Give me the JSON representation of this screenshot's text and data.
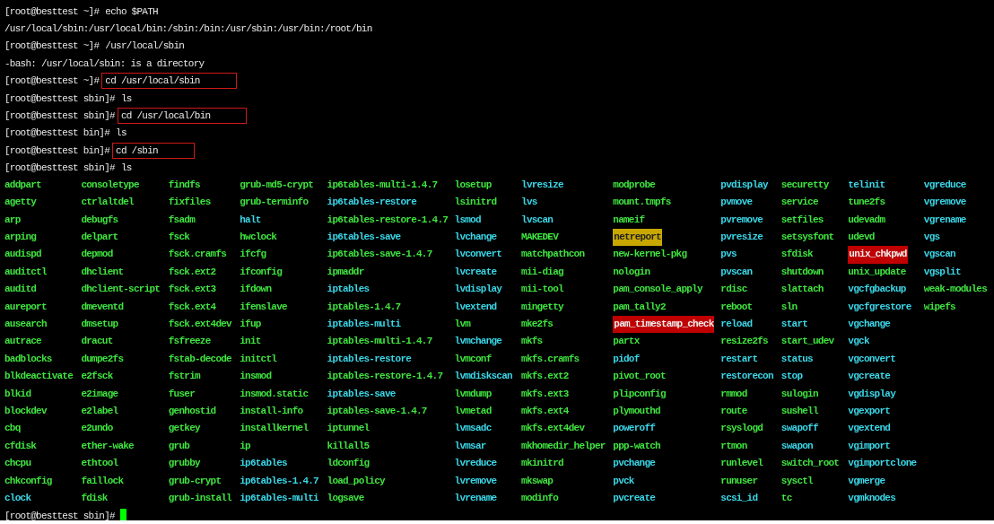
{
  "lines": [
    {
      "kind": "prompt",
      "prompt": "[root@besttest ~]#",
      "command": "echo $PATH",
      "boxed": false
    },
    {
      "kind": "output",
      "text": "/usr/local/sbin:/usr/local/bin:/sbin:/bin:/usr/sbin:/usr/bin:/root/bin"
    },
    {
      "kind": "prompt",
      "prompt": "[root@besttest ~]#",
      "command": "/usr/local/sbin",
      "boxed": false
    },
    {
      "kind": "output",
      "text": "-bash: /usr/local/sbin: is a directory"
    },
    {
      "kind": "prompt",
      "prompt": "[root@besttest ~]#",
      "command": "cd /usr/local/sbin",
      "boxed": true
    },
    {
      "kind": "prompt",
      "prompt": "[root@besttest sbin]#",
      "command": "ls",
      "boxed": false
    },
    {
      "kind": "prompt",
      "prompt": "[root@besttest sbin]#",
      "command": "cd /usr/local/bin",
      "boxed": true
    },
    {
      "kind": "prompt",
      "prompt": "[root@besttest bin]#",
      "command": "ls",
      "boxed": false
    },
    {
      "kind": "prompt",
      "prompt": "[root@besttest bin]#",
      "command": "cd /sbin",
      "boxed": true
    },
    {
      "kind": "prompt",
      "prompt": "[root@besttest sbin]#",
      "command": "ls",
      "boxed": false
    }
  ],
  "listing": [
    [
      {
        "name": "addpart",
        "kind": "exec"
      },
      {
        "name": "agetty",
        "kind": "exec"
      },
      {
        "name": "arp",
        "kind": "exec"
      },
      {
        "name": "arping",
        "kind": "exec"
      },
      {
        "name": "audispd",
        "kind": "exec"
      },
      {
        "name": "auditctl",
        "kind": "exec"
      },
      {
        "name": "auditd",
        "kind": "exec"
      },
      {
        "name": "aureport",
        "kind": "exec"
      },
      {
        "name": "ausearch",
        "kind": "exec"
      },
      {
        "name": "autrace",
        "kind": "exec"
      },
      {
        "name": "badblocks",
        "kind": "exec"
      },
      {
        "name": "blkdeactivate",
        "kind": "exec"
      },
      {
        "name": "blkid",
        "kind": "exec"
      },
      {
        "name": "blockdev",
        "kind": "exec"
      },
      {
        "name": "cbq",
        "kind": "exec"
      },
      {
        "name": "cfdisk",
        "kind": "exec"
      },
      {
        "name": "chcpu",
        "kind": "exec"
      },
      {
        "name": "chkconfig",
        "kind": "exec"
      },
      {
        "name": "clock",
        "kind": "link"
      }
    ],
    [
      {
        "name": "consoletype",
        "kind": "exec"
      },
      {
        "name": "ctrlaltdel",
        "kind": "exec"
      },
      {
        "name": "debugfs",
        "kind": "exec"
      },
      {
        "name": "delpart",
        "kind": "exec"
      },
      {
        "name": "depmod",
        "kind": "exec"
      },
      {
        "name": "dhclient",
        "kind": "exec"
      },
      {
        "name": "dhclient-script",
        "kind": "exec"
      },
      {
        "name": "dmeventd",
        "kind": "exec"
      },
      {
        "name": "dmsetup",
        "kind": "exec"
      },
      {
        "name": "dracut",
        "kind": "exec"
      },
      {
        "name": "dumpe2fs",
        "kind": "exec"
      },
      {
        "name": "e2fsck",
        "kind": "exec"
      },
      {
        "name": "e2image",
        "kind": "exec"
      },
      {
        "name": "e2label",
        "kind": "exec"
      },
      {
        "name": "e2undo",
        "kind": "exec"
      },
      {
        "name": "ether-wake",
        "kind": "exec"
      },
      {
        "name": "ethtool",
        "kind": "exec"
      },
      {
        "name": "faillock",
        "kind": "exec"
      },
      {
        "name": "fdisk",
        "kind": "exec"
      }
    ],
    [
      {
        "name": "findfs",
        "kind": "exec"
      },
      {
        "name": "fixfiles",
        "kind": "exec"
      },
      {
        "name": "fsadm",
        "kind": "exec"
      },
      {
        "name": "fsck",
        "kind": "exec"
      },
      {
        "name": "fsck.cramfs",
        "kind": "exec"
      },
      {
        "name": "fsck.ext2",
        "kind": "exec"
      },
      {
        "name": "fsck.ext3",
        "kind": "exec"
      },
      {
        "name": "fsck.ext4",
        "kind": "exec"
      },
      {
        "name": "fsck.ext4dev",
        "kind": "exec"
      },
      {
        "name": "fsfreeze",
        "kind": "exec"
      },
      {
        "name": "fstab-decode",
        "kind": "exec"
      },
      {
        "name": "fstrim",
        "kind": "exec"
      },
      {
        "name": "fuser",
        "kind": "exec"
      },
      {
        "name": "genhostid",
        "kind": "exec"
      },
      {
        "name": "getkey",
        "kind": "exec"
      },
      {
        "name": "grub",
        "kind": "exec"
      },
      {
        "name": "grubby",
        "kind": "exec"
      },
      {
        "name": "grub-crypt",
        "kind": "exec"
      },
      {
        "name": "grub-install",
        "kind": "exec"
      }
    ],
    [
      {
        "name": "grub-md5-crypt",
        "kind": "exec"
      },
      {
        "name": "grub-terminfo",
        "kind": "exec"
      },
      {
        "name": "halt",
        "kind": "link"
      },
      {
        "name": "hwclock",
        "kind": "exec"
      },
      {
        "name": "ifcfg",
        "kind": "exec"
      },
      {
        "name": "ifconfig",
        "kind": "exec"
      },
      {
        "name": "ifdown",
        "kind": "exec"
      },
      {
        "name": "ifenslave",
        "kind": "exec"
      },
      {
        "name": "ifup",
        "kind": "exec"
      },
      {
        "name": "init",
        "kind": "exec"
      },
      {
        "name": "initctl",
        "kind": "exec"
      },
      {
        "name": "insmod",
        "kind": "exec"
      },
      {
        "name": "insmod.static",
        "kind": "exec"
      },
      {
        "name": "install-info",
        "kind": "exec"
      },
      {
        "name": "installkernel",
        "kind": "exec"
      },
      {
        "name": "ip",
        "kind": "exec"
      },
      {
        "name": "ip6tables",
        "kind": "link"
      },
      {
        "name": "ip6tables-1.4.7",
        "kind": "link"
      },
      {
        "name": "ip6tables-multi",
        "kind": "link"
      }
    ],
    [
      {
        "name": "ip6tables-multi-1.4.7",
        "kind": "exec"
      },
      {
        "name": "ip6tables-restore",
        "kind": "link"
      },
      {
        "name": "ip6tables-restore-1.4.7",
        "kind": "exec"
      },
      {
        "name": "ip6tables-save",
        "kind": "link"
      },
      {
        "name": "ip6tables-save-1.4.7",
        "kind": "exec"
      },
      {
        "name": "ipmaddr",
        "kind": "exec"
      },
      {
        "name": "iptables",
        "kind": "link"
      },
      {
        "name": "iptables-1.4.7",
        "kind": "exec"
      },
      {
        "name": "iptables-multi",
        "kind": "link"
      },
      {
        "name": "iptables-multi-1.4.7",
        "kind": "exec"
      },
      {
        "name": "iptables-restore",
        "kind": "link"
      },
      {
        "name": "iptables-restore-1.4.7",
        "kind": "exec"
      },
      {
        "name": "iptables-save",
        "kind": "link"
      },
      {
        "name": "iptables-save-1.4.7",
        "kind": "exec"
      },
      {
        "name": "iptunnel",
        "kind": "exec"
      },
      {
        "name": "killall5",
        "kind": "exec"
      },
      {
        "name": "ldconfig",
        "kind": "exec"
      },
      {
        "name": "load_policy",
        "kind": "exec"
      },
      {
        "name": "logsave",
        "kind": "exec"
      }
    ],
    [
      {
        "name": "losetup",
        "kind": "exec"
      },
      {
        "name": "lsinitrd",
        "kind": "exec"
      },
      {
        "name": "lsmod",
        "kind": "link"
      },
      {
        "name": "lvchange",
        "kind": "link"
      },
      {
        "name": "lvconvert",
        "kind": "link"
      },
      {
        "name": "lvcreate",
        "kind": "link"
      },
      {
        "name": "lvdisplay",
        "kind": "link"
      },
      {
        "name": "lvextend",
        "kind": "link"
      },
      {
        "name": "lvm",
        "kind": "exec"
      },
      {
        "name": "lvmchange",
        "kind": "link"
      },
      {
        "name": "lvmconf",
        "kind": "exec"
      },
      {
        "name": "lvmdiskscan",
        "kind": "link"
      },
      {
        "name": "lvmdump",
        "kind": "exec"
      },
      {
        "name": "lvmetad",
        "kind": "exec"
      },
      {
        "name": "lvmsadc",
        "kind": "link"
      },
      {
        "name": "lvmsar",
        "kind": "link"
      },
      {
        "name": "lvreduce",
        "kind": "link"
      },
      {
        "name": "lvremove",
        "kind": "link"
      },
      {
        "name": "lvrename",
        "kind": "link"
      }
    ],
    [
      {
        "name": "lvresize",
        "kind": "link"
      },
      {
        "name": "lvs",
        "kind": "link"
      },
      {
        "name": "lvscan",
        "kind": "link"
      },
      {
        "name": "MAKEDEV",
        "kind": "exec"
      },
      {
        "name": "matchpathcon",
        "kind": "exec"
      },
      {
        "name": "mii-diag",
        "kind": "exec"
      },
      {
        "name": "mii-tool",
        "kind": "exec"
      },
      {
        "name": "mingetty",
        "kind": "exec"
      },
      {
        "name": "mke2fs",
        "kind": "exec"
      },
      {
        "name": "mkfs",
        "kind": "exec"
      },
      {
        "name": "mkfs.cramfs",
        "kind": "exec"
      },
      {
        "name": "mkfs.ext2",
        "kind": "exec"
      },
      {
        "name": "mkfs.ext3",
        "kind": "exec"
      },
      {
        "name": "mkfs.ext4",
        "kind": "exec"
      },
      {
        "name": "mkfs.ext4dev",
        "kind": "exec"
      },
      {
        "name": "mkhomedir_helper",
        "kind": "exec"
      },
      {
        "name": "mkinitrd",
        "kind": "exec"
      },
      {
        "name": "mkswap",
        "kind": "exec"
      },
      {
        "name": "modinfo",
        "kind": "exec"
      }
    ],
    [
      {
        "name": "modprobe",
        "kind": "exec"
      },
      {
        "name": "mount.tmpfs",
        "kind": "exec"
      },
      {
        "name": "nameif",
        "kind": "exec"
      },
      {
        "name": "netreport",
        "kind": "setgid"
      },
      {
        "name": "new-kernel-pkg",
        "kind": "exec"
      },
      {
        "name": "nologin",
        "kind": "exec"
      },
      {
        "name": "pam_console_apply",
        "kind": "exec"
      },
      {
        "name": "pam_tally2",
        "kind": "exec"
      },
      {
        "name": "pam_timestamp_check",
        "kind": "setuid"
      },
      {
        "name": "partx",
        "kind": "exec"
      },
      {
        "name": "pidof",
        "kind": "link"
      },
      {
        "name": "pivot_root",
        "kind": "exec"
      },
      {
        "name": "plipconfig",
        "kind": "exec"
      },
      {
        "name": "plymouthd",
        "kind": "exec"
      },
      {
        "name": "poweroff",
        "kind": "link"
      },
      {
        "name": "ppp-watch",
        "kind": "exec"
      },
      {
        "name": "pvchange",
        "kind": "link"
      },
      {
        "name": "pvck",
        "kind": "link"
      },
      {
        "name": "pvcreate",
        "kind": "link"
      }
    ],
    [
      {
        "name": "pvdisplay",
        "kind": "link"
      },
      {
        "name": "pvmove",
        "kind": "link"
      },
      {
        "name": "pvremove",
        "kind": "link"
      },
      {
        "name": "pvresize",
        "kind": "link"
      },
      {
        "name": "pvs",
        "kind": "link"
      },
      {
        "name": "pvscan",
        "kind": "link"
      },
      {
        "name": "rdisc",
        "kind": "exec"
      },
      {
        "name": "reboot",
        "kind": "exec"
      },
      {
        "name": "reload",
        "kind": "link"
      },
      {
        "name": "resize2fs",
        "kind": "exec"
      },
      {
        "name": "restart",
        "kind": "link"
      },
      {
        "name": "restorecon",
        "kind": "link"
      },
      {
        "name": "rmmod",
        "kind": "exec"
      },
      {
        "name": "route",
        "kind": "exec"
      },
      {
        "name": "rsyslogd",
        "kind": "exec"
      },
      {
        "name": "rtmon",
        "kind": "exec"
      },
      {
        "name": "runlevel",
        "kind": "exec"
      },
      {
        "name": "runuser",
        "kind": "exec"
      },
      {
        "name": "scsi_id",
        "kind": "link"
      }
    ],
    [
      {
        "name": "securetty",
        "kind": "exec"
      },
      {
        "name": "service",
        "kind": "exec"
      },
      {
        "name": "setfiles",
        "kind": "exec"
      },
      {
        "name": "setsysfont",
        "kind": "exec"
      },
      {
        "name": "sfdisk",
        "kind": "exec"
      },
      {
        "name": "shutdown",
        "kind": "exec"
      },
      {
        "name": "slattach",
        "kind": "exec"
      },
      {
        "name": "sln",
        "kind": "exec"
      },
      {
        "name": "start",
        "kind": "link"
      },
      {
        "name": "start_udev",
        "kind": "exec"
      },
      {
        "name": "status",
        "kind": "link"
      },
      {
        "name": "stop",
        "kind": "link"
      },
      {
        "name": "sulogin",
        "kind": "exec"
      },
      {
        "name": "sushell",
        "kind": "exec"
      },
      {
        "name": "swapoff",
        "kind": "link"
      },
      {
        "name": "swapon",
        "kind": "link"
      },
      {
        "name": "switch_root",
        "kind": "exec"
      },
      {
        "name": "sysctl",
        "kind": "exec"
      },
      {
        "name": "tc",
        "kind": "exec"
      }
    ],
    [
      {
        "name": "telinit",
        "kind": "link"
      },
      {
        "name": "tune2fs",
        "kind": "exec"
      },
      {
        "name": "udevadm",
        "kind": "exec"
      },
      {
        "name": "udevd",
        "kind": "exec"
      },
      {
        "name": "unix_chkpwd",
        "kind": "setuid"
      },
      {
        "name": "unix_update",
        "kind": "exec"
      },
      {
        "name": "vgcfgbackup",
        "kind": "link"
      },
      {
        "name": "vgcfgrestore",
        "kind": "link"
      },
      {
        "name": "vgchange",
        "kind": "link"
      },
      {
        "name": "vgck",
        "kind": "link"
      },
      {
        "name": "vgconvert",
        "kind": "link"
      },
      {
        "name": "vgcreate",
        "kind": "link"
      },
      {
        "name": "vgdisplay",
        "kind": "link"
      },
      {
        "name": "vgexport",
        "kind": "link"
      },
      {
        "name": "vgextend",
        "kind": "link"
      },
      {
        "name": "vgimport",
        "kind": "link"
      },
      {
        "name": "vgimportclone",
        "kind": "link"
      },
      {
        "name": "vgmerge",
        "kind": "link"
      },
      {
        "name": "vgmknodes",
        "kind": "link"
      }
    ],
    [
      {
        "name": "vgreduce",
        "kind": "link"
      },
      {
        "name": "vgremove",
        "kind": "link"
      },
      {
        "name": "vgrename",
        "kind": "link"
      },
      {
        "name": "vgs",
        "kind": "link"
      },
      {
        "name": "vgscan",
        "kind": "link"
      },
      {
        "name": "vgsplit",
        "kind": "link"
      },
      {
        "name": "weak-modules",
        "kind": "exec"
      },
      {
        "name": "wipefs",
        "kind": "exec"
      }
    ]
  ],
  "final_prompt": {
    "prompt": "[root@besttest sbin]#",
    "cursor": true
  }
}
